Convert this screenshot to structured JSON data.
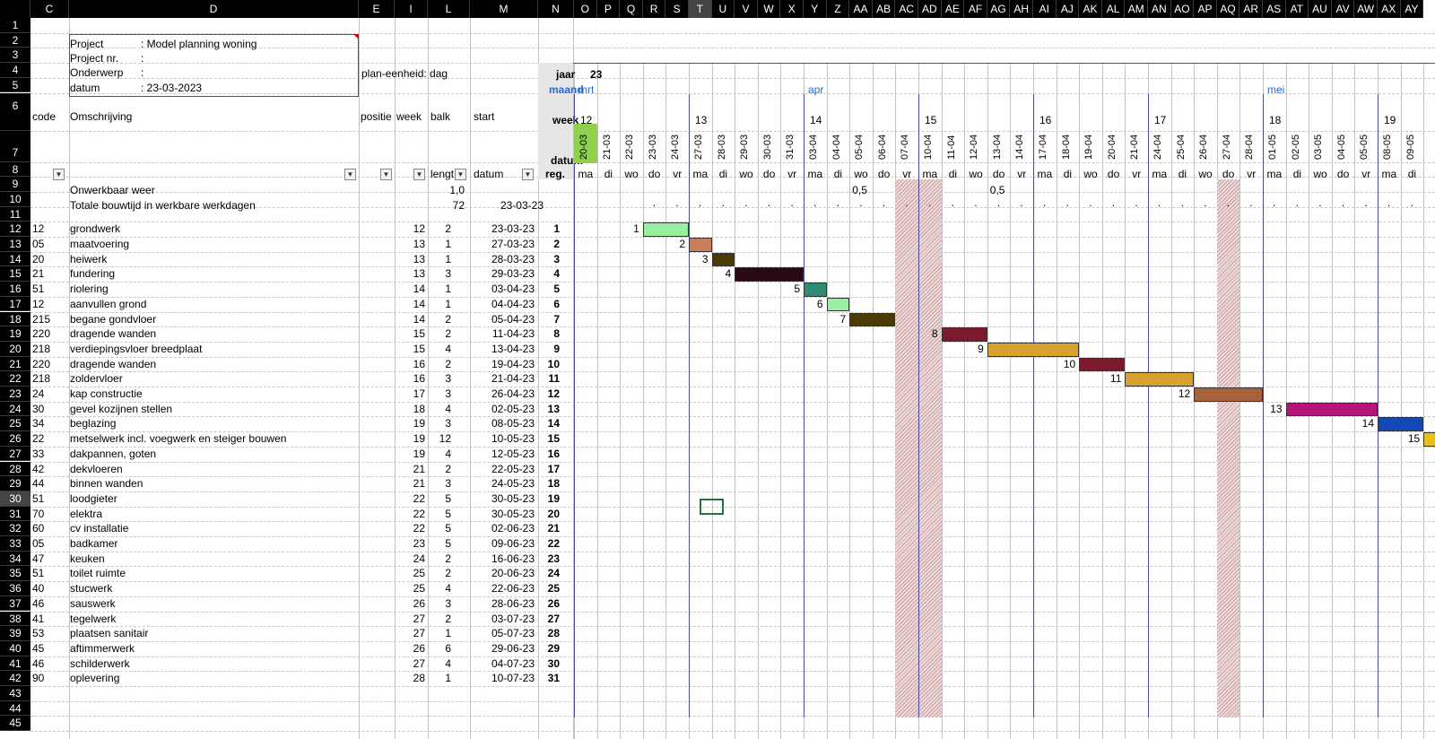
{
  "sheet": {
    "columns": [
      "C",
      "D",
      "E",
      "I",
      "L",
      "M",
      "N",
      "O",
      "P",
      "Q",
      "R",
      "S",
      "T",
      "U",
      "V",
      "W",
      "X",
      "Y",
      "Z",
      "AA",
      "AB",
      "AC",
      "AD",
      "AE",
      "AF",
      "AG",
      "AH",
      "AI",
      "AJ",
      "AK",
      "AL",
      "AM",
      "AN",
      "AO",
      "AP",
      "AQ",
      "AR",
      "AS",
      "AT",
      "AU",
      "AV",
      "AW",
      "AX",
      "AY"
    ],
    "selected_column": "T",
    "rows": [
      "1",
      "2",
      "3",
      "4",
      "5",
      "6",
      "7",
      "8",
      "9",
      "10",
      "11",
      "12",
      "13",
      "14",
      "15",
      "16",
      "17",
      "18",
      "19",
      "20",
      "21",
      "22",
      "23",
      "24",
      "25",
      "26",
      "27",
      "28",
      "29",
      "30",
      "31",
      "32",
      "33",
      "34",
      "35",
      "36",
      "37",
      "38",
      "39",
      "40",
      "41",
      "42",
      "43",
      "44",
      "45"
    ],
    "selected_row": "30"
  },
  "header": {
    "project_label": "Project",
    "project_value": ": Model planning woning",
    "projectnr_label": "Project nr.",
    "projectnr_value": ":",
    "subject_label": "Onderwerp",
    "subject_value": ":",
    "date_label": "datum",
    "date_value": ": 23-03-2023",
    "plan_unit": "plan-eenheid: dag"
  },
  "col_headers": {
    "code": "code",
    "desc": "Omschrijving",
    "pos": "positie",
    "week": "week",
    "bar": "balk",
    "start": "start",
    "length": "lengt",
    "datum": "datum",
    "reg": "reg."
  },
  "timeline_labels": {
    "year_label": "jaar",
    "year_value": "23",
    "month_label": "maand",
    "week_label": "week",
    "date_label": "datum",
    "months": [
      {
        "label": "mrt",
        "col": 0
      },
      {
        "label": "apr",
        "col": 10
      },
      {
        "label": "mei",
        "col": 30
      }
    ],
    "weeks": [
      {
        "label": "12",
        "col": 0
      },
      {
        "label": "13",
        "col": 5
      },
      {
        "label": "14",
        "col": 10
      },
      {
        "label": "15",
        "col": 15
      },
      {
        "label": "16",
        "col": 20
      },
      {
        "label": "17",
        "col": 25
      },
      {
        "label": "18",
        "col": 30
      },
      {
        "label": "19",
        "col": 35
      }
    ],
    "dates": [
      "20-03",
      "21-03",
      "22-03",
      "23-03",
      "24-03",
      "27-03",
      "28-03",
      "29-03",
      "30-03",
      "31-03",
      "03-04",
      "04-04",
      "05-04",
      "06-04",
      "07-04",
      "10-04",
      "11-04",
      "12-04",
      "13-04",
      "14-04",
      "17-04",
      "18-04",
      "19-04",
      "20-04",
      "21-04",
      "24-04",
      "25-04",
      "26-04",
      "27-04",
      "28-04",
      "01-05",
      "02-05",
      "03-05",
      "04-05",
      "05-05",
      "08-05",
      "09-05"
    ],
    "days": [
      "ma",
      "di",
      "wo",
      "do",
      "vr",
      "ma",
      "di",
      "wo",
      "do",
      "vr",
      "ma",
      "di",
      "wo",
      "do",
      "vr",
      "ma",
      "di",
      "wo",
      "do",
      "vr",
      "ma",
      "di",
      "wo",
      "do",
      "vr",
      "ma",
      "di",
      "wo",
      "do",
      "vr",
      "ma",
      "di",
      "wo",
      "do",
      "vr",
      "ma",
      "di"
    ]
  },
  "summary": {
    "weather_label": "Onwerkbaar weer",
    "weather_value": "1,0",
    "weather_days": [
      {
        "col": 12,
        "value": "0,5"
      },
      {
        "col": 18,
        "value": "0,5"
      }
    ],
    "total_label": "Totale bouwtijd in werkbare werkdagen",
    "total_value": "72",
    "total_date": "23-03-23"
  },
  "tasks": [
    {
      "code": "12",
      "desc": "grondwerk",
      "week": "12",
      "len": "2",
      "start": "23-03-23",
      "reg": "1",
      "bar_start": 3,
      "bar_len": 2,
      "color": "#99f0a0"
    },
    {
      "code": "05",
      "desc": "maatvoering",
      "week": "13",
      "len": "1",
      "start": "27-03-23",
      "reg": "2",
      "bar_start": 5,
      "bar_len": 1,
      "color": "#c87e5e"
    },
    {
      "code": "20",
      "desc": "heiwerk",
      "week": "13",
      "len": "1",
      "start": "28-03-23",
      "reg": "3",
      "bar_start": 6,
      "bar_len": 1,
      "color": "#4a3a06"
    },
    {
      "code": "21",
      "desc": "fundering",
      "week": "13",
      "len": "3",
      "start": "29-03-23",
      "reg": "4",
      "bar_start": 7,
      "bar_len": 3,
      "color": "#2a0a12"
    },
    {
      "code": "51",
      "desc": "riolering",
      "week": "14",
      "len": "1",
      "start": "03-04-23",
      "reg": "5",
      "bar_start": 10,
      "bar_len": 1,
      "color": "#2f8c74"
    },
    {
      "code": "12",
      "desc": "aanvullen grond",
      "week": "14",
      "len": "1",
      "start": "04-04-23",
      "reg": "6",
      "bar_start": 11,
      "bar_len": 1,
      "color": "#99f0a0"
    },
    {
      "code": "215",
      "desc": "begane gondvloer",
      "week": "14",
      "len": "2",
      "start": "05-04-23",
      "reg": "7",
      "bar_start": 12,
      "bar_len": 2,
      "color": "#4a3a06"
    },
    {
      "code": "220",
      "desc": "dragende wanden",
      "week": "15",
      "len": "2",
      "start": "11-04-23",
      "reg": "8",
      "bar_start": 16,
      "bar_len": 2,
      "color": "#7a1a2c"
    },
    {
      "code": "218",
      "desc": "verdiepingsvloer breedplaat",
      "week": "15",
      "len": "4",
      "start": "13-04-23",
      "reg": "9",
      "bar_start": 18,
      "bar_len": 4,
      "color": "#d9a22c"
    },
    {
      "code": "220",
      "desc": "dragende wanden",
      "week": "16",
      "len": "2",
      "start": "19-04-23",
      "reg": "10",
      "bar_start": 22,
      "bar_len": 2,
      "color": "#7a1a2c"
    },
    {
      "code": "218",
      "desc": "zoldervloer",
      "week": "16",
      "len": "3",
      "start": "21-04-23",
      "reg": "11",
      "bar_start": 24,
      "bar_len": 3,
      "color": "#d9a22c"
    },
    {
      "code": "24",
      "desc": "kap constructie",
      "week": "17",
      "len": "3",
      "start": "26-04-23",
      "reg": "12",
      "bar_start": 27,
      "bar_len": 3,
      "color": "#a8623a"
    },
    {
      "code": "30",
      "desc": "gevel kozijnen stellen",
      "week": "18",
      "len": "4",
      "start": "02-05-23",
      "reg": "13",
      "bar_start": 31,
      "bar_len": 4,
      "color": "#b5157a"
    },
    {
      "code": "34",
      "desc": "beglazing",
      "week": "19",
      "len": "3",
      "start": "08-05-23",
      "reg": "14",
      "bar_start": 35,
      "bar_len": 2,
      "color": "#1248b8"
    },
    {
      "code": "22",
      "desc": "metselwerk incl. voegwerk en steiger bouwen",
      "week": "19",
      "len": "12",
      "start": "10-05-23",
      "reg": "15",
      "bar_start": 37,
      "bar_len": 1,
      "color": "#e8c020"
    },
    {
      "code": "33",
      "desc": "dakpannen, goten",
      "week": "19",
      "len": "4",
      "start": "12-05-23",
      "reg": "16"
    },
    {
      "code": "42",
      "desc": "dekvloeren",
      "week": "21",
      "len": "2",
      "start": "22-05-23",
      "reg": "17"
    },
    {
      "code": "44",
      "desc": "binnen wanden",
      "week": "21",
      "len": "3",
      "start": "24-05-23",
      "reg": "18"
    },
    {
      "code": "51",
      "desc": "loodgieter",
      "week": "22",
      "len": "5",
      "start": "30-05-23",
      "reg": "19"
    },
    {
      "code": "70",
      "desc": "elektra",
      "week": "22",
      "len": "5",
      "start": "30-05-23",
      "reg": "20"
    },
    {
      "code": "60",
      "desc": "cv installatie",
      "week": "22",
      "len": "5",
      "start": "02-06-23",
      "reg": "21"
    },
    {
      "code": "05",
      "desc": "badkamer",
      "week": "23",
      "len": "5",
      "start": "09-06-23",
      "reg": "22"
    },
    {
      "code": "47",
      "desc": "keuken",
      "week": "24",
      "len": "2",
      "start": "16-06-23",
      "reg": "23"
    },
    {
      "code": "51",
      "desc": "toilet ruimte",
      "week": "25",
      "len": "2",
      "start": "20-06-23",
      "reg": "24"
    },
    {
      "code": "40",
      "desc": "stucwerk",
      "week": "25",
      "len": "4",
      "start": "22-06-23",
      "reg": "25"
    },
    {
      "code": "46",
      "desc": "sauswerk",
      "week": "26",
      "len": "3",
      "start": "28-06-23",
      "reg": "26"
    },
    {
      "code": "41",
      "desc": "tegelwerk",
      "week": "27",
      "len": "2",
      "start": "03-07-23",
      "reg": "27"
    },
    {
      "code": "53",
      "desc": "plaatsen sanitair",
      "week": "27",
      "len": "1",
      "start": "05-07-23",
      "reg": "28"
    },
    {
      "code": "45",
      "desc": "aftimmerwerk",
      "week": "26",
      "len": "6",
      "start": "29-06-23",
      "reg": "29"
    },
    {
      "code": "46",
      "desc": "schilderwerk",
      "week": "27",
      "len": "4",
      "start": "04-07-23",
      "reg": "30"
    },
    {
      "code": "90",
      "desc": "oplevering",
      "week": "28",
      "len": "1",
      "start": "10-07-23",
      "reg": "31"
    }
  ],
  "holidays": [
    {
      "col": 14,
      "width": 2
    },
    {
      "col": 28,
      "width": 1
    }
  ],
  "colors": {
    "today": "#8fd14f",
    "week_line": "#4a4aa0",
    "timeline_header_bg": "#e6e6e6",
    "selection": "#217346"
  }
}
